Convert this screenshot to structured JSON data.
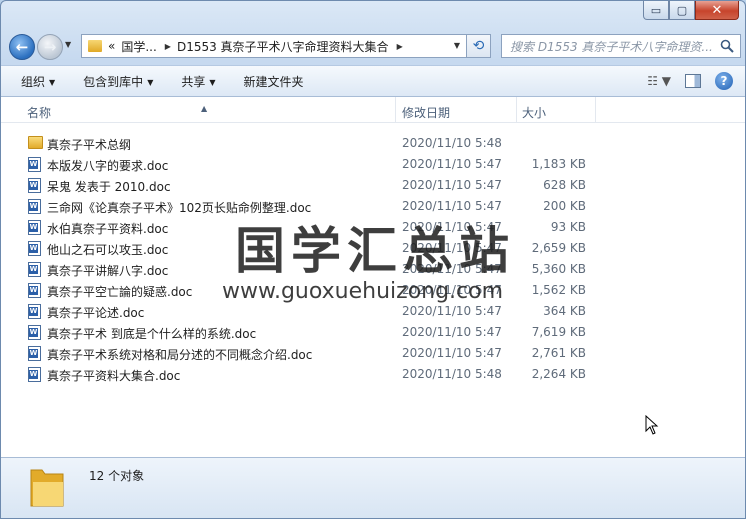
{
  "window": {
    "min_glyph": "▭",
    "max_glyph": "▢",
    "close_glyph": "✕"
  },
  "nav": {
    "crumb_prefix": "«",
    "crumb_parent": "国学...",
    "crumb_current": "D1553 真奈子平术八字命理资料大集合",
    "search_placeholder": "搜索 D1553 真奈子平术八字命理资..."
  },
  "toolbar": {
    "organize": "组织",
    "include_library": "包含到库中",
    "share": "共享",
    "new_folder": "新建文件夹"
  },
  "columns": {
    "name": "名称",
    "date": "修改日期",
    "size": "大小"
  },
  "files": [
    {
      "type": "folder",
      "name": "真奈子平术总纲",
      "date": "2020/11/10 5:48",
      "size": ""
    },
    {
      "type": "doc",
      "name": "本版发八字的要求.doc",
      "date": "2020/11/10 5:47",
      "size": "1,183 KB"
    },
    {
      "type": "doc",
      "name": "呆鬼 发表于 2010.doc",
      "date": "2020/11/10 5:47",
      "size": "628 KB"
    },
    {
      "type": "doc",
      "name": "三命网《论真奈子平术》102页长贴命例整理.doc",
      "date": "2020/11/10 5:47",
      "size": "200 KB"
    },
    {
      "type": "doc",
      "name": "水伯真奈子平资料.doc",
      "date": "2020/11/10 5:47",
      "size": "93 KB"
    },
    {
      "type": "doc",
      "name": "他山之石可以攻玉.doc",
      "date": "2020/11/10 5:47",
      "size": "2,659 KB"
    },
    {
      "type": "doc",
      "name": "真奈子平讲解八字.doc",
      "date": "2020/11/10 5:47",
      "size": "5,360 KB"
    },
    {
      "type": "doc",
      "name": "真奈子平空亡論的疑惑.doc",
      "date": "2020/11/10 5:47",
      "size": "1,562 KB"
    },
    {
      "type": "doc",
      "name": "真奈子平论述.doc",
      "date": "2020/11/10 5:47",
      "size": "364 KB"
    },
    {
      "type": "doc",
      "name": "真奈子平术 到底是个什么样的系统.doc",
      "date": "2020/11/10 5:47",
      "size": "7,619 KB"
    },
    {
      "type": "doc",
      "name": "真奈子平术系统对格和局分述的不同概念介绍.doc",
      "date": "2020/11/10 5:47",
      "size": "2,761 KB"
    },
    {
      "type": "doc",
      "name": "真奈子平资料大集合.doc",
      "date": "2020/11/10 5:48",
      "size": "2,264 KB"
    }
  ],
  "watermark": {
    "title": "国学汇总站",
    "url": "www.guoxuehuizong.com"
  },
  "status": {
    "count_text": "12 个对象"
  }
}
